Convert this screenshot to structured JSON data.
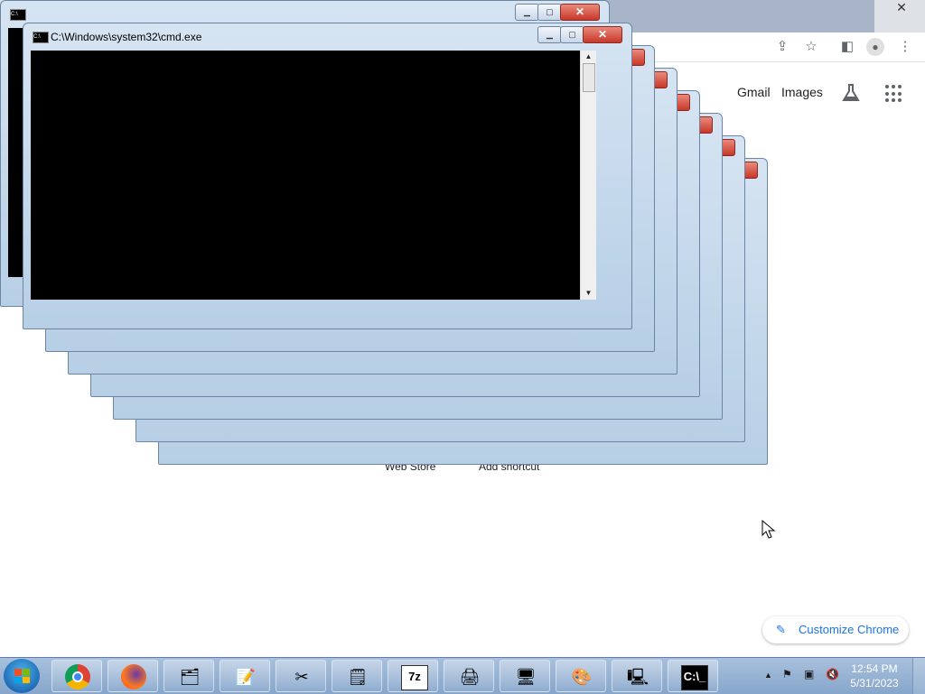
{
  "chrome": {
    "close_glyph": "✕",
    "gmail": "Gmail",
    "images": "Images",
    "customize": "Customize Chrome",
    "shortcut_web_store": "Web Store",
    "shortcut_add": "Add shortcut"
  },
  "cmd": {
    "title": "C:\\Windows\\system32\\cmd.exe",
    "icon_text": "C:\\",
    "min": "▁",
    "max": "▢",
    "close": "✕",
    "scroll_up": "▲",
    "scroll_down": "▼"
  },
  "taskbar": {
    "items": [
      {
        "icon": "chrome-icon"
      },
      {
        "icon": "firefox-icon"
      },
      {
        "icon": "explorer-icon"
      },
      {
        "icon": "notepad-icon"
      },
      {
        "icon": "snipping-tool-icon"
      },
      {
        "icon": "sticky-notes-icon"
      },
      {
        "icon": "7zip-icon",
        "text": "7z"
      },
      {
        "icon": "printer-icon"
      },
      {
        "icon": "control-panel-icon"
      },
      {
        "icon": "paint-icon"
      },
      {
        "icon": "remote-desktop-icon"
      },
      {
        "icon": "cmd-icon",
        "text": "C:\\_"
      }
    ],
    "tray_arrow": "▲",
    "time": "12:54 PM",
    "date": "5/31/2023"
  }
}
